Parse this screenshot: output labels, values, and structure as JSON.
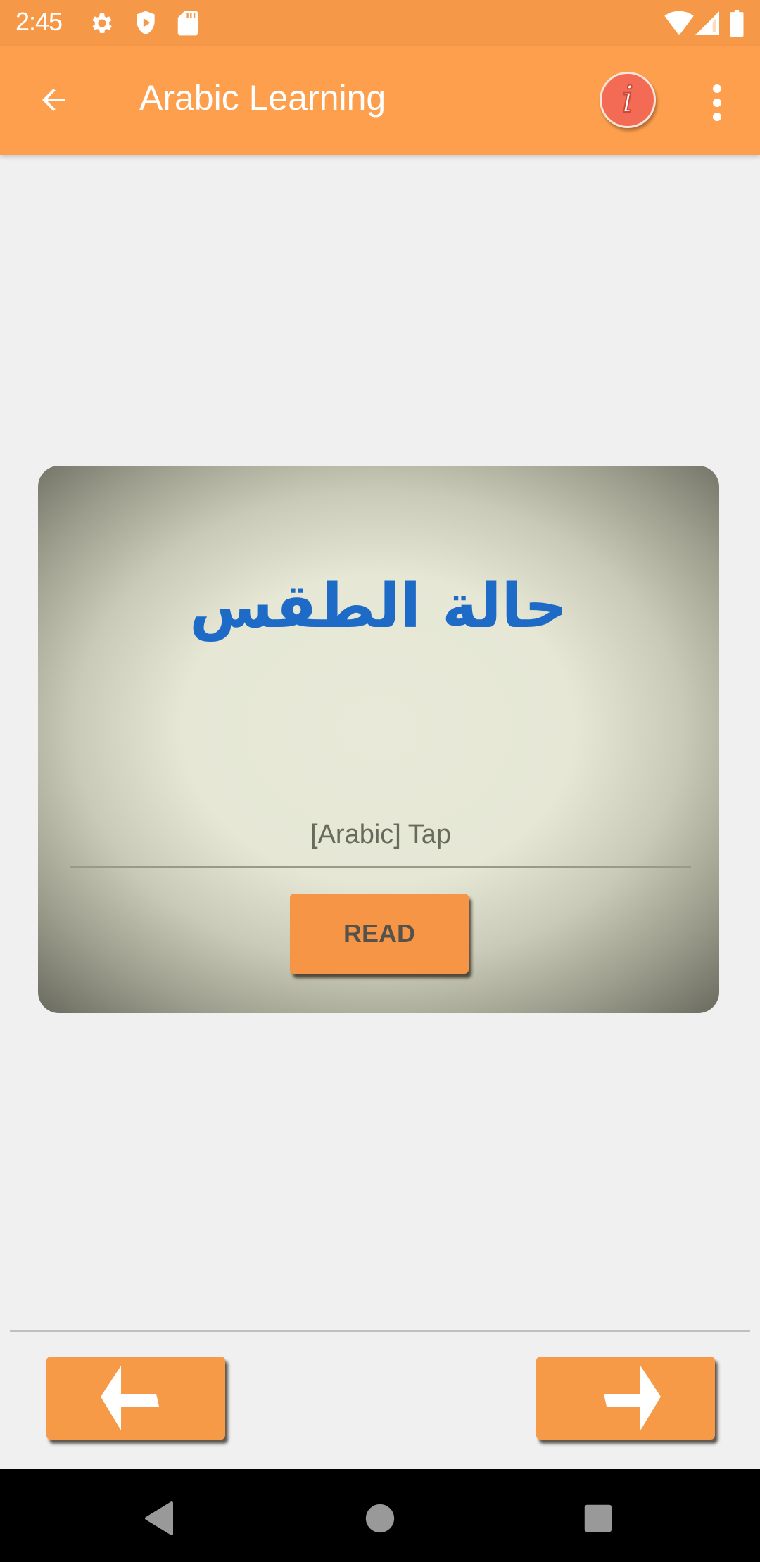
{
  "status_bar": {
    "time": "2:45",
    "left_icons": [
      "gear-icon",
      "shield-play-icon",
      "sd-card-icon"
    ],
    "right_icons": [
      "wifi-icon",
      "signal-icon",
      "battery-icon"
    ]
  },
  "app_bar": {
    "title": "Arabic Learning",
    "back_icon": "arrow-left-icon",
    "info_glyph": "i",
    "overflow_icon": "more-vert-icon"
  },
  "card": {
    "arabic_word": "حالة الطقس",
    "input_placeholder": "[Arabic] Tap",
    "input_value": "",
    "read_label": "READ"
  },
  "navigation": {
    "prev_icon": "arrow-left-icon",
    "next_icon": "arrow-right-icon"
  },
  "system_nav": {
    "back": "back-triangle-icon",
    "home": "home-circle-icon",
    "recents": "recents-square-icon"
  },
  "colors": {
    "status_bar": "#f59847",
    "app_bar": "#fe9f4e",
    "button": "#f59545",
    "arabic_text": "#1d6bc7",
    "info_badge": "#f36a55",
    "background": "#f0f0f0"
  }
}
